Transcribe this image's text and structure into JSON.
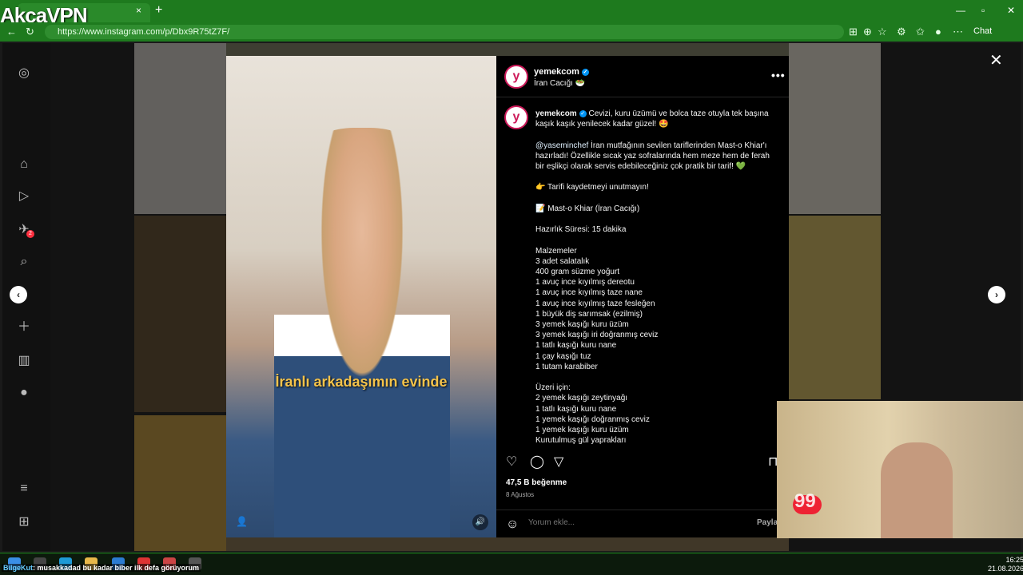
{
  "browser": {
    "overlay_logo": "AkcaVPN",
    "url": "https://www.instagram.com/p/Dbx9R75tZ7F/",
    "new_tab": "+",
    "tab_close": "×",
    "chat_label": "Chat",
    "window_controls": [
      "—",
      "▫",
      "✕"
    ]
  },
  "sidebar": {
    "notification_count": "2",
    "items": [
      "instagram-icon",
      "home-icon",
      "reels-icon",
      "messages-icon",
      "search-icon",
      "create-icon",
      "dashboard-icon",
      "profile-icon",
      "menu-icon",
      "apps-icon"
    ]
  },
  "post": {
    "username": "yemekcom",
    "verified": "✓",
    "subtitle": "İran Cacığı 🥗",
    "more": "•••",
    "caption_user": "yemekcom",
    "caption_lead": " Cevizi, kuru üzümü ve bolca taze otuyla tek başına kaşık kaşık yenilecek kadar güzel! 🤩",
    "mention": "@yaseminchef",
    "caption_body": " İran mutfağının sevilen tariflerinden Mast-o Khiar'ı hazırladı! Özellikle sıcak yaz sofralarında hem meze hem de ferah bir eşlikçi olarak servis edebileceğiniz çok pratik bir tarif! 💚\n\n👉 Tarifi kaydetmeyi unutmayın!\n\n📝 Mast-o Khiar (İran Cacığı)\n\nHazırlık Süresi: 15 dakika\n\nMalzemeler\n3 adet salatalık\n400 gram süzme yoğurt\n1 avuç ince kıyılmış dereotu\n1 avuç ince kıyılmış taze nane\n1 avuç ince kıyılmış taze fesleğen\n1 büyük diş sarımsak (ezilmiş)\n3 yemek kaşığı kuru üzüm\n3 yemek kaşığı iri doğranmış ceviz\n1 tatlı kaşığı kuru nane\n1 çay kaşığı tuz\n1 tutam karabiber\n\nÜzeri için:\n2 yemek kaşığı zeytinyağı\n1 tatlı kaşığı kuru nane\n1 yemek kaşığı doğranmış ceviz\n1 yemek kaşığı kuru üzüm\nKurutulmuş gül yaprakları",
    "likes": "47,5 B beğenme",
    "date": "8 Ağustos",
    "comment_placeholder": "Yorum ekle...",
    "post_button": "Payla",
    "video_caption": "İranlı arkadaşımın evinde",
    "avatar_letter": "y"
  },
  "modal": {
    "close": "✕",
    "prev": "‹",
    "next": "›"
  },
  "webcam": {
    "score": "99"
  },
  "taskbar": {
    "ticker_name": "BilgeKut",
    "ticker_text": ": musakkadad bu kadar biber ilk defa görüyorum",
    "time": "16:25",
    "date": "21.08.2026"
  },
  "colors": {
    "browser_green": "#1e7a1e",
    "verified_blue": "#0095f6",
    "brand": "#cd1a5a"
  }
}
